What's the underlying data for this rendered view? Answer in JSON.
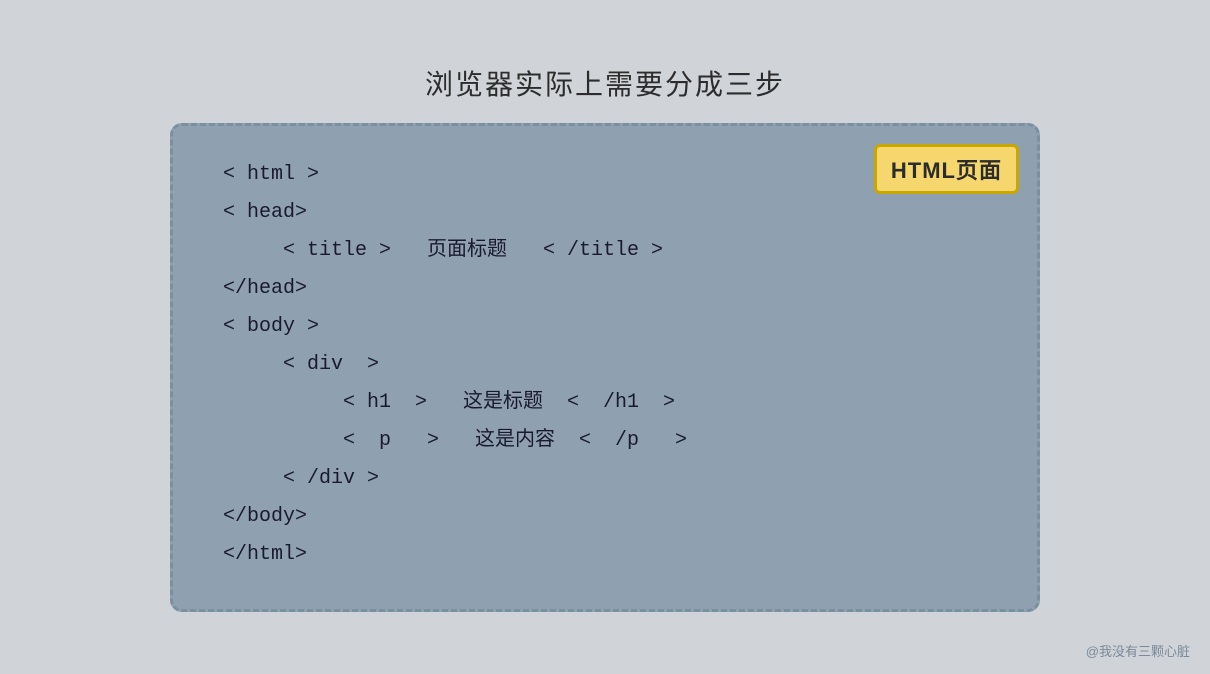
{
  "page": {
    "title": "浏览器实际上需要分成三步",
    "background_color": "#d0d3d8"
  },
  "badge": {
    "label": "HTML页面",
    "bg_color": "#f5d76e",
    "border_color": "#c8a800"
  },
  "code": {
    "lines": [
      {
        "text": "< html >",
        "indent": 0
      },
      {
        "text": "< head>",
        "indent": 0
      },
      {
        "text": "< title >   页面标题   < /title >",
        "indent": 1
      },
      {
        "text": "</head>",
        "indent": 0
      },
      {
        "text": "< body >",
        "indent": 0
      },
      {
        "text": "< div  >",
        "indent": 1
      },
      {
        "text": "< h1  >   这是标题  <  /h1  >",
        "indent": 2
      },
      {
        "text": "<  p   >   这是内容  <  /p   >",
        "indent": 2
      },
      {
        "text": "< /div >",
        "indent": 1
      },
      {
        "text": "</body>",
        "indent": 0
      },
      {
        "text": "</html>",
        "indent": 0
      }
    ]
  },
  "watermark": {
    "text": "@我没有三颗心脏"
  }
}
